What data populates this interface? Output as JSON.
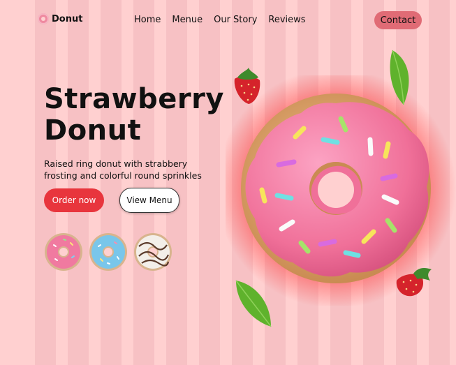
{
  "nav": {
    "brand": "Donut",
    "links": [
      "Home",
      "Menue",
      "Our Story",
      "Reviews"
    ],
    "contact": "Contact"
  },
  "hero": {
    "title_line1": "Strawberry",
    "title_line2": "Donut",
    "subtitle": "Raised ring donut with strabbery frosting and colorful round sprinkles",
    "order_button": "Order now",
    "view_button": "View Menu"
  },
  "thumbnails": [
    {
      "name": "pink donut",
      "frosting": "#f07aa0"
    },
    {
      "name": "blue donut",
      "frosting": "#79c6ea"
    },
    {
      "name": "chocolate drizzle donut",
      "frosting": "#f3efe9"
    }
  ],
  "colors": {
    "background": "#ffd0d0",
    "accent_red": "#e8353d",
    "contact_bg": "#e06b75",
    "frosting_pink": "#f27fa4",
    "glow_red": "#ff2a2a"
  }
}
